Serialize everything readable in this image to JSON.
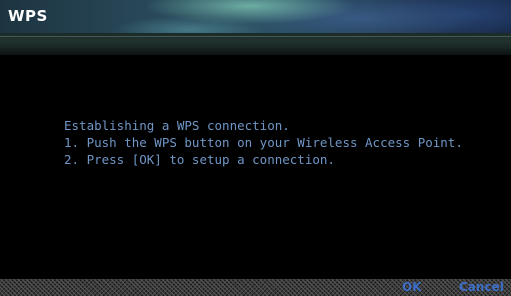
{
  "window": {
    "title": "WPS"
  },
  "message": {
    "lines": [
      "Establishing a WPS connection.",
      "1. Push the WPS button on your Wireless Access Point.",
      "2. Press [OK] to setup a connection."
    ]
  },
  "footer": {
    "ok_label": "OK",
    "cancel_label": "Cancel"
  },
  "colors": {
    "background": "#000000",
    "message_text": "#6f96c6",
    "footer_button_text": "#3d6fc9",
    "title_text": "#ffffff"
  }
}
